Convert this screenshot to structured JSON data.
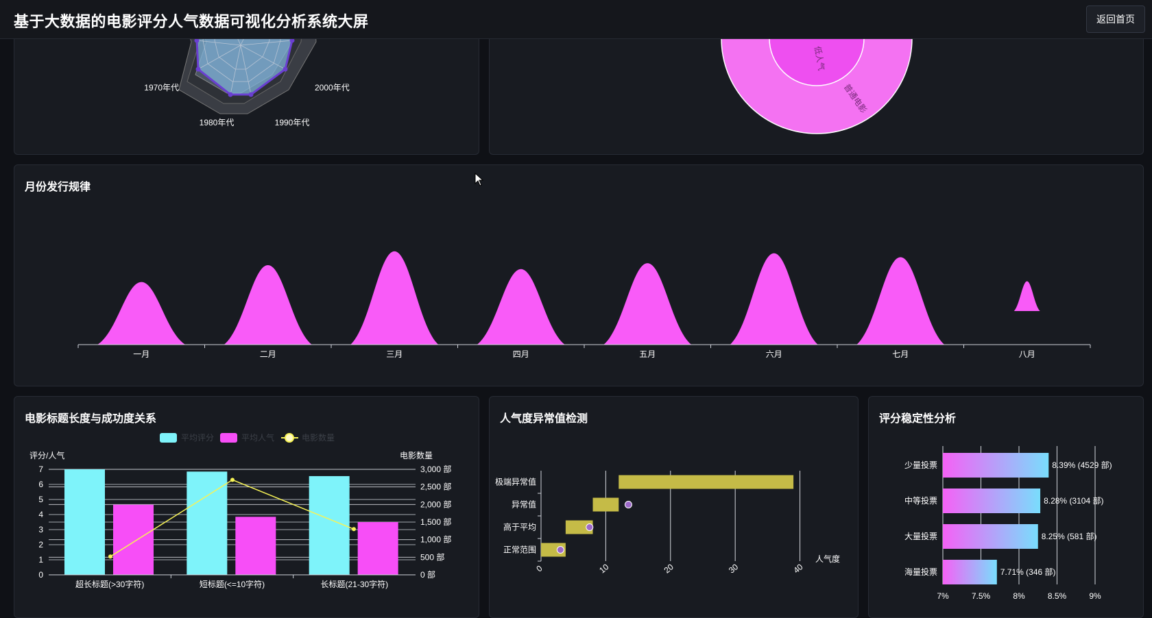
{
  "header": {
    "title": "基于大数据的电影评分人气数据可视化分析系统大屏",
    "back_label": "返回首页"
  },
  "radar_panel": {
    "labels": [
      "1970年代",
      "2000年代",
      "1980年代",
      "1990年代"
    ]
  },
  "pie_panel": {
    "labels": [
      "低人气",
      "普通电影"
    ],
    "colors": {
      "outer": "#f472f2",
      "inner": "#ee4ff0"
    }
  },
  "month_panel": {
    "title": "月份发行规律",
    "chart_data": {
      "type": "area",
      "categories": [
        "一月",
        "二月",
        "三月",
        "四月",
        "五月",
        "六月",
        "七月",
        "八月"
      ],
      "values": [
        0.63,
        0.8,
        0.94,
        0.76,
        0.82,
        0.92,
        0.88,
        0.3
      ],
      "color": "#f95bf8"
    }
  },
  "title_panel": {
    "title": "电影标题长度与成功度关系",
    "chart_data": {
      "type": "bar",
      "categories": [
        "超长标题(>30字符)",
        "短标题(<=10字符)",
        "长标题(21-30字符)"
      ],
      "series": [
        {
          "name": "平均评分",
          "values": [
            7.0,
            6.85,
            6.55
          ],
          "color": "#7ef3fa"
        },
        {
          "name": "平均人气",
          "values": [
            4.65,
            3.85,
            3.5
          ],
          "color": "#f74ef7"
        },
        {
          "name": "电影数量",
          "values": [
            520,
            2700,
            1300
          ],
          "color": "#f7f356",
          "type": "line"
        }
      ],
      "ylabel_left": "评分/人气",
      "ylabel_right": "电影数量",
      "ylim_left": [
        0,
        7
      ],
      "ylim_right": [
        0,
        3000
      ],
      "left_ticks": [
        "0",
        "1",
        "2",
        "3",
        "4",
        "5",
        "6",
        "7"
      ],
      "right_ticks": [
        "0 部",
        "500 部",
        "1,000 部",
        "1,500 部",
        "2,000 部",
        "2,500 部",
        "3,000 部"
      ]
    }
  },
  "outlier_panel": {
    "title": "人气度异常值检测",
    "chart_data": {
      "type": "bar",
      "categories": [
        "正常范围",
        "高于平均",
        "异常值",
        "极端异常值"
      ],
      "ranges": [
        [
          0,
          3.8
        ],
        [
          3.8,
          8
        ],
        [
          8,
          12
        ],
        [
          12,
          39
        ]
      ],
      "points": [
        3,
        7.5,
        13.5,
        null
      ],
      "xlabel": "人气度",
      "xlim": [
        0,
        41
      ],
      "x_ticks": [
        "0",
        "10",
        "20",
        "30",
        "40"
      ],
      "bar_color": "#c5bb47",
      "point_color": "#9d69c9"
    }
  },
  "stability_panel": {
    "title": "评分稳定性分析",
    "chart_data": {
      "type": "bar",
      "categories": [
        "少量投票",
        "中等投票",
        "大量投票",
        "海量投票"
      ],
      "values": [
        8.39,
        8.28,
        8.25,
        7.71
      ],
      "labels": [
        "8.39% (4529 部)",
        "8.28% (3104 部)",
        "8.25% (581 部)",
        "7.71% (346 部)"
      ],
      "xlim": [
        7,
        9
      ],
      "x_ticks": [
        "7%",
        "7.5%",
        "8%",
        "8.5%",
        "9%"
      ],
      "gradient": [
        "#f561f6",
        "#79ddfc"
      ]
    }
  }
}
